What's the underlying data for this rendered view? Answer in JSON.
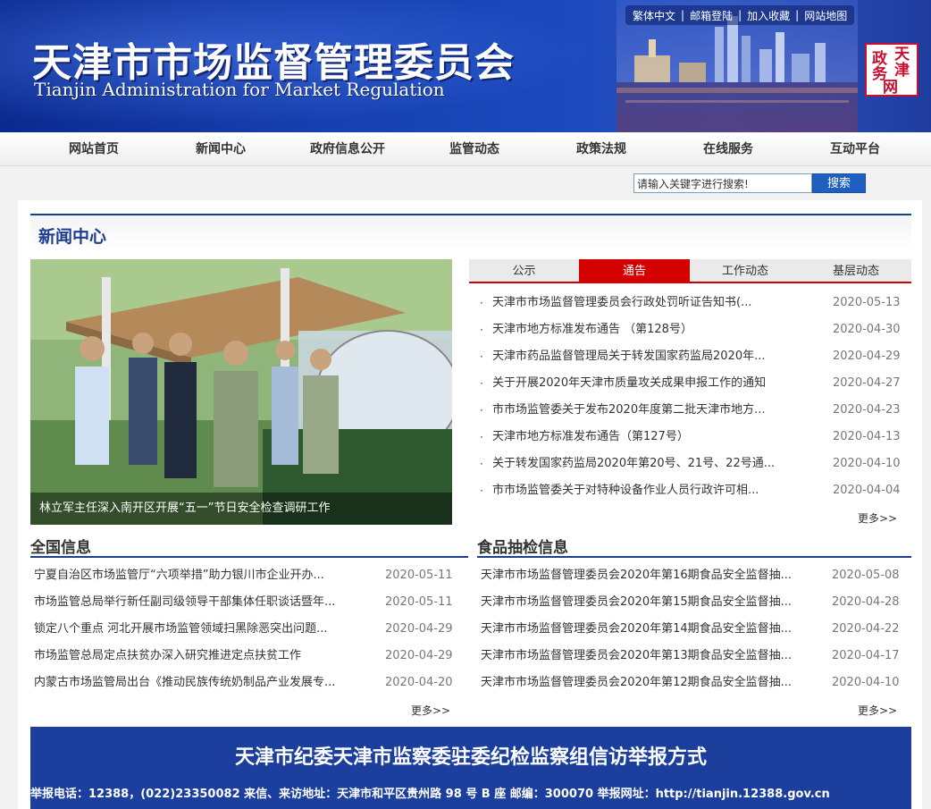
{
  "banner": {
    "title_cn": "天津市市场监督管理委员会",
    "title_en": "Tianjin Administration for Market Regulation",
    "top_links": [
      "繁体中文",
      "邮箱登陆",
      "加入收藏",
      "网站地图"
    ],
    "seal_chars": [
      "天",
      "津",
      "政",
      "务",
      "网"
    ]
  },
  "nav": {
    "items": [
      "网站首页",
      "新闻中心",
      "政府信息公开",
      "监管动态",
      "政策法规",
      "在线服务",
      "互动平台"
    ]
  },
  "search": {
    "value": "请输入关键字进行搜索!",
    "button": "搜索"
  },
  "news_center": {
    "title": "新闻中心",
    "photo_caption": "林立军主任深入南开区开展“五一”节日安全检查调研工作",
    "tabs": [
      "公示",
      "通告",
      "工作动态",
      "基层动态"
    ],
    "active_tab": 1,
    "items": [
      {
        "title": "天津市市场监督管理委员会行政处罚听证告知书(...",
        "date": "2020-05-13"
      },
      {
        "title": "天津市地方标准发布通告 （第128号）",
        "date": "2020-04-30"
      },
      {
        "title": "天津市药品监督管理局关于转发国家药监局2020年...",
        "date": "2020-04-29"
      },
      {
        "title": "关于开展2020年天津市质量攻关成果申报工作的通知",
        "date": "2020-04-27"
      },
      {
        "title": "市市场监管委关于发布2020年度第二批天津市地方...",
        "date": "2020-04-23"
      },
      {
        "title": "天津市地方标准发布通告（第127号）",
        "date": "2020-04-13"
      },
      {
        "title": "关于转发国家药监局2020年第20号、21号、22号通...",
        "date": "2020-04-10"
      },
      {
        "title": "市市场监管委关于对特种设备作业人员行政许可相...",
        "date": "2020-04-04"
      }
    ],
    "more": "更多>>"
  },
  "national": {
    "title": "全国信息",
    "items": [
      {
        "title": "宁夏自治区市场监管厅“六项举措”助力银川市企业开办...",
        "date": "2020-05-11"
      },
      {
        "title": "市场监管总局举行新任副司级领导干部集体任职谈话暨年...",
        "date": "2020-05-11"
      },
      {
        "title": "锁定八个重点 河北开展市场监管领域扫黑除恶突出问题...",
        "date": "2020-04-29"
      },
      {
        "title": "市场监管总局定点扶贫办深入研究推进定点扶贫工作",
        "date": "2020-04-29"
      },
      {
        "title": "内蒙古市场监管局出台《推动民族传统奶制品产业发展专...",
        "date": "2020-04-20"
      }
    ],
    "more": "更多>>"
  },
  "food": {
    "title": "食品抽检信息",
    "items": [
      {
        "title": "天津市市场监督管理委员会2020年第16期食品安全监督抽...",
        "date": "2020-05-08"
      },
      {
        "title": "天津市市场监督管理委员会2020年第15期食品安全监督抽...",
        "date": "2020-04-28"
      },
      {
        "title": "天津市市场监督管理委员会2020年第14期食品安全监督抽...",
        "date": "2020-04-22"
      },
      {
        "title": "天津市市场监督管理委员会2020年第13期食品安全监督抽...",
        "date": "2020-04-17"
      },
      {
        "title": "天津市市场监督管理委员会2020年第12期食品安全监督抽...",
        "date": "2020-04-10"
      }
    ],
    "more": "更多>>"
  },
  "report": {
    "title": "天津市纪委天津市监察委驻委纪检监察组信访举报方式",
    "line": "举报电话：12388，(022)23350082 来信、来访地址：天津市和平区贵州路 98 号 B 座 邮编：300070 举报网址：http://tianjin.12388.gov.cn"
  },
  "colors": {
    "banner_blue": "#1740b0",
    "section_blue": "#1c3d91",
    "active_tab_red": "#d50000",
    "search_button": "#1f5fc0"
  }
}
